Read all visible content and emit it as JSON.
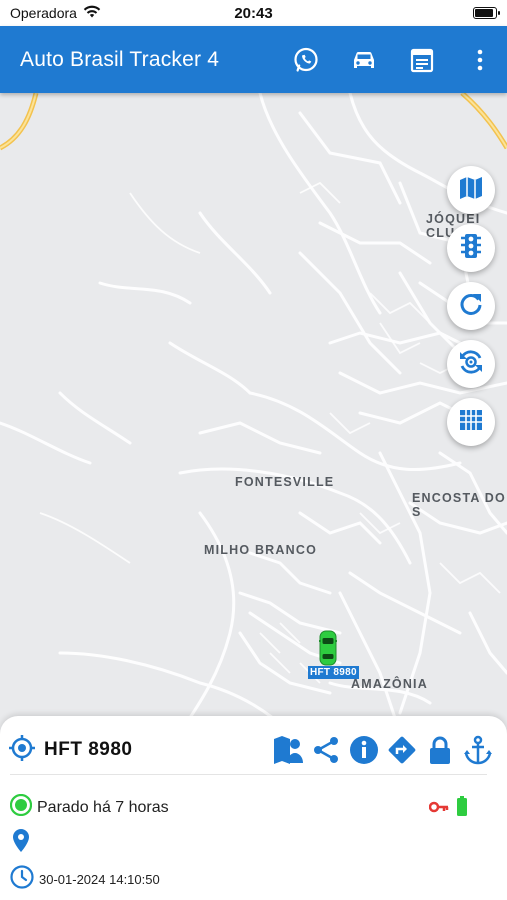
{
  "status_bar": {
    "carrier": "Operadora",
    "time": "20:43"
  },
  "app_bar": {
    "title": "Auto Brasil Tracker 4",
    "actions": [
      "whatsapp-icon",
      "car-icon",
      "calendar-icon",
      "more-vert-icon"
    ]
  },
  "map": {
    "labels": {
      "jockey": "JÓQUEI CLU",
      "fontesville": "FONTESVILLE",
      "encosta": "ENCOSTA DO S",
      "milho_branco": "MILHO BRANCO",
      "amazonia": "AMAZÔNIA"
    },
    "fab_buttons": [
      "map-layers-icon",
      "traffic-light-icon",
      "refresh-icon",
      "auto-refresh-icon",
      "grid-icon"
    ],
    "vehicle_marker": {
      "plate": "HFT 8980",
      "color": "#2ecc40"
    }
  },
  "panel": {
    "vehicle_name": "HFT 8980",
    "actions": [
      "map-person-icon",
      "share-icon",
      "info-icon",
      "directions-icon",
      "lock-icon",
      "anchor-icon"
    ],
    "status_text": "Parado há 7 horas",
    "datetime": "30-01-2024 14:10:50",
    "colors": {
      "primary": "#1f7ad1",
      "status_ok": "#2ecc40",
      "ignition_off": "#e53935"
    }
  }
}
